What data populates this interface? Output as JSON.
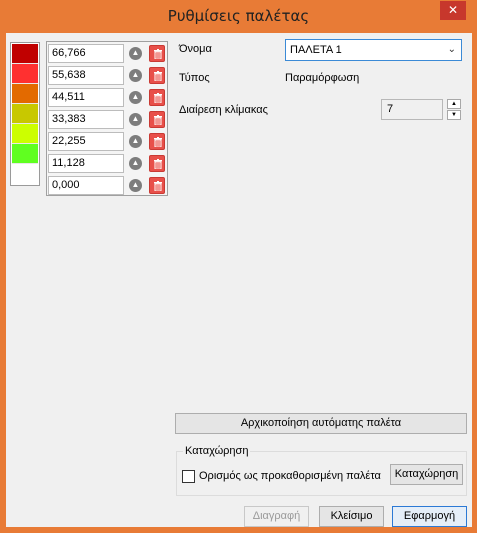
{
  "window": {
    "title": "Ρυθμίσεις παλέτας",
    "close_glyph": "✕"
  },
  "colors": {
    "title_bar": "#e87b36",
    "close_button": "#c7372c",
    "delete_button": "#e8504a"
  },
  "palette": {
    "swatches": [
      "#c00000",
      "#ff3030",
      "#e36a00",
      "#c8c800",
      "#ccff00",
      "#60ff20"
    ],
    "values": [
      "66,766",
      "55,638",
      "44,511",
      "33,383",
      "22,255",
      "11,128",
      "0,000"
    ],
    "row_icons": {
      "move": "up-arrow-circle-icon",
      "delete": "trash-icon"
    }
  },
  "form": {
    "name_label": "Όνομα",
    "name_value": "ΠΑΛΕΤΑ 1",
    "type_label": "Τύπος",
    "type_value": "Παραμόρφωση",
    "scale_label": "Διαίρεση κλίμακας",
    "scale_value": "7"
  },
  "buttons": {
    "init_auto": "Αρχικοποίηση αυτόματης παλέτα",
    "register": "Καταχώρηση",
    "delete": "Διαγραφή",
    "close": "Κλείσιμο",
    "apply": "Εφαρμογή"
  },
  "registration_group": {
    "title": "Καταχώρηση",
    "default_checkbox_label": "Ορισμός ως προκαθορισμένη παλέτα",
    "default_checked": false
  }
}
